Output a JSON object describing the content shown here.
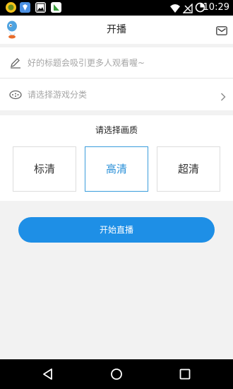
{
  "status_bar": {
    "time": "10:29",
    "left_icons": [
      "chat-app-icon",
      "shield-app-icon",
      "gallery-icon",
      "store-icon"
    ],
    "right_icons": [
      "wifi-icon",
      "no-signal-icon",
      "battery-icon"
    ]
  },
  "header": {
    "title": "开播",
    "left_icon": "mascot-logo-icon",
    "right_icon": "mail-icon"
  },
  "form": {
    "title_placeholder": "好的标题会吸引更多人观看喔~",
    "category_label": "请选择游戏分类"
  },
  "quality": {
    "title": "请选择画质",
    "options": [
      {
        "label": "标清",
        "selected": false
      },
      {
        "label": "高清",
        "selected": true
      },
      {
        "label": "超清",
        "selected": false
      }
    ]
  },
  "actions": {
    "start_label": "开始直播"
  },
  "colors": {
    "accent": "#1e8fe6",
    "selected_text": "#2a90d8",
    "background": "#f2f2f2"
  }
}
